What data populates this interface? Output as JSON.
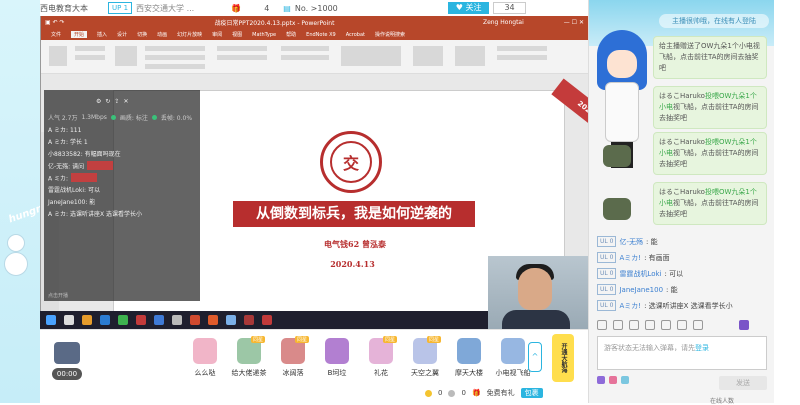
{
  "topbar": {
    "left_title": "西电教育大本",
    "level": "UP 1",
    "school": "西安交通大学 ...",
    "gift_count": "4",
    "rank": "No. >1000",
    "follow_count": "34"
  },
  "ppt": {
    "title": "战疫日常PPT2020.4.13.pptx - PowerPoint",
    "user": "Zeng Hongtai",
    "tabs": [
      "文件",
      "开始",
      "插入",
      "设计",
      "切换",
      "动画",
      "幻灯片放映",
      "审阅",
      "视图",
      "MathType",
      "帮助",
      "EndNote X9",
      "Acrobat",
      "操作说明搜索"
    ],
    "active_tab": "开始",
    "slide": {
      "sash": "2020.4",
      "logo_char": "交",
      "banner": "从倒数到标兵，我是如何逆袭的",
      "author": "电气钱62 曾泓泰",
      "date": "2020.4.13"
    }
  },
  "overlay": {
    "header": "人气 2.7万",
    "stat1": "1.3Mbps",
    "stat2": "画质: 标注",
    "stat3": "丢帧: 0.0%",
    "lines": [
      "A ミカ: 111",
      "A ミカ: 学长 1",
      "小8833582: 有幅面吗现在",
      "亿-无殇: 请问",
      "A ミカ:",
      "雷霆战机Loki: 可以",
      "JaneJane100: 能",
      "A ミカ: 选课听讲座X 选课看学长小"
    ],
    "footer": "点击开播"
  },
  "webcam": {
    "label": "webcam"
  },
  "giftbar": {
    "timer": "00:00",
    "gifts": [
      {
        "label": "么么哒",
        "tag": "",
        "color": "#f1b5c8"
      },
      {
        "label": "给大佬递茶",
        "tag": "同星",
        "color": "#9cc7a6"
      },
      {
        "label": "冰阔落",
        "tag": "同星",
        "color": "#d98a8a"
      },
      {
        "label": "B坷垃",
        "tag": "",
        "color": "#b27fd1"
      },
      {
        "label": "礼花",
        "tag": "同星",
        "color": "#e5b3d8"
      },
      {
        "label": "天空之翼",
        "tag": "同星",
        "color": "#b9c4e8"
      },
      {
        "label": "摩天大楼",
        "tag": "",
        "color": "#7fa8d8"
      },
      {
        "label": "小电视飞船",
        "tag": "",
        "color": "#97b7e2"
      }
    ],
    "open_label": "开通大航海",
    "coin1": "0",
    "coin2": "0",
    "gift_link": "免费有礼",
    "package": "包裹"
  },
  "chat": {
    "header_pill": "主播很帅哦，在线有人登陆",
    "msgs": [
      {
        "prefix": "",
        "hl": "",
        "text": "给主播赠送了OW九朵1个小电视飞船，点击前往TA的房间去抽奖吧"
      },
      {
        "prefix": "はるこHaruko",
        "hl": "投喂OW九朵1个小电",
        "text": "视飞船，点击前往TA的房间去抽奖吧"
      },
      {
        "prefix": "はるこHaruko",
        "hl": "投喂OW九朵1个小电",
        "text": "视飞船，点击前往TA的房间去抽奖吧"
      },
      {
        "prefix": "はるこHaruko",
        "hl": "投喂OW九朵1个小电",
        "text": "视飞船，点击前往TA的房间去抽奖吧"
      }
    ],
    "lines": [
      {
        "lvl": "UL 0",
        "name": "亿-无殇",
        "text": ": 能"
      },
      {
        "lvl": "UL 0",
        "name": "Aミカ!",
        "text": ": 有画面"
      },
      {
        "lvl": "UL 0",
        "name": "雷霆战机Loki",
        "text": ": 可以"
      },
      {
        "lvl": "UL 0",
        "name": "JaneJane100",
        "text": ": 能"
      },
      {
        "lvl": "UL 0",
        "name": "Aミカ!",
        "text": ": 选课听讲座X 选课看学长小"
      }
    ],
    "input_placeholder": "游客状态无法输入弹幕，请先",
    "login_link": "登录",
    "send_button": "发送"
  },
  "decor": {
    "hungry": "hungry"
  },
  "bottom": "在线人数"
}
